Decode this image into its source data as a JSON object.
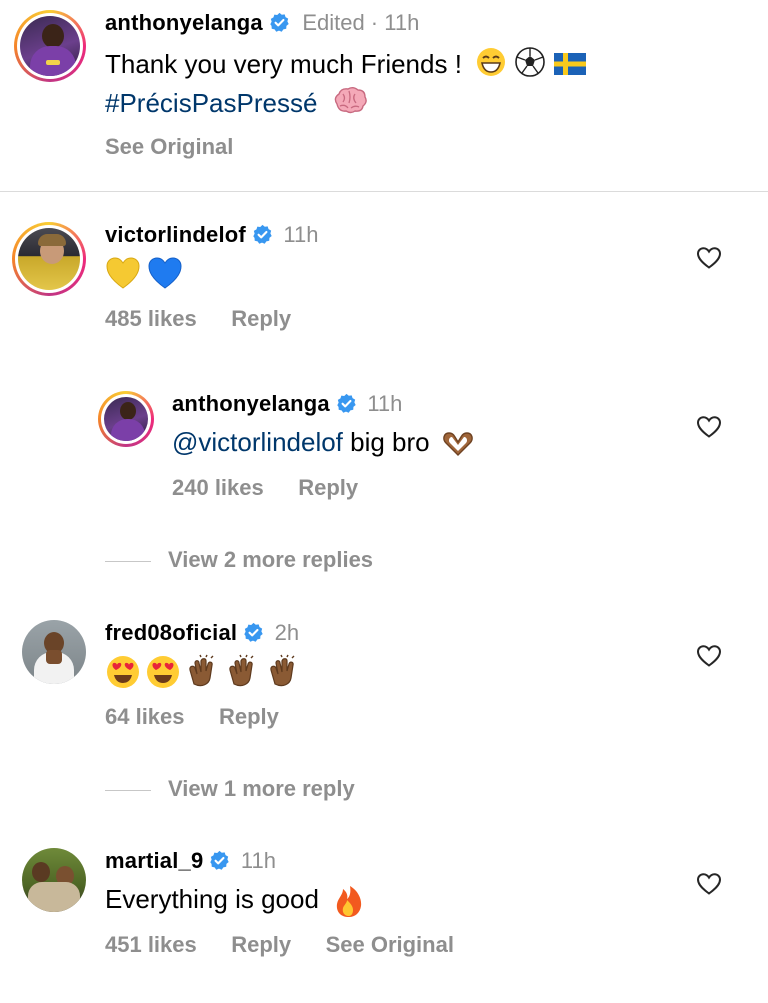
{
  "caption": {
    "username": "anthonyelanga",
    "meta": "Edited · 11h",
    "text": "Thank you very much Friends !",
    "hashtag": "#PrécisPasPressé",
    "see_original": "See Original"
  },
  "comments": [
    {
      "username": "victorlindelof",
      "time": "11h",
      "likes": "485 likes",
      "reply": "Reply"
    },
    {
      "username": "anthonyelanga",
      "time": "11h",
      "mention": "@victorlindelof",
      "text": " big bro",
      "likes": "240 likes",
      "reply": "Reply"
    },
    {
      "username": "fred08oficial",
      "time": "2h",
      "likes": "64 likes",
      "reply": "Reply"
    },
    {
      "username": "martial_9",
      "time": "11h",
      "text": "Everything is good",
      "likes": "451 likes",
      "reply": "Reply",
      "see_original": "See Original"
    }
  ],
  "view_more": [
    "View 2 more replies",
    "View 1 more reply"
  ],
  "icons": {
    "verified": "verified-badge-icon",
    "heart": "heart-outline-icon"
  },
  "colors": {
    "verified": "#3897f0",
    "link": "#00376b",
    "secondary": "#8e8e8e"
  }
}
